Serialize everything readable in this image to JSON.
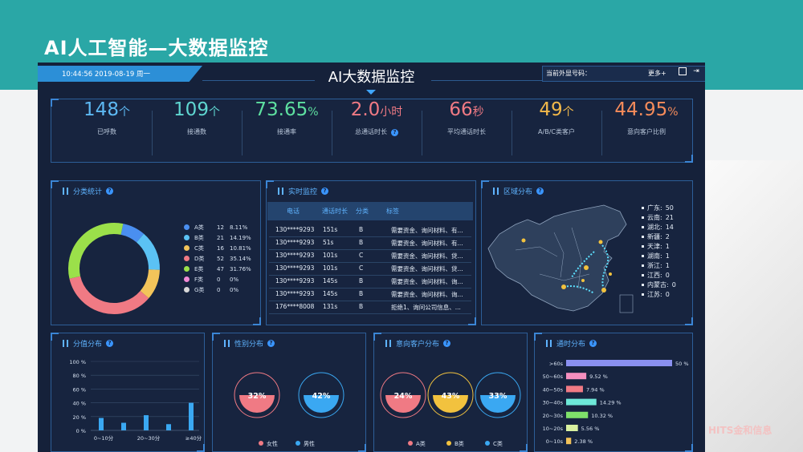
{
  "slide": {
    "title": "AI人工智能—大数据监控",
    "logo": "HITS金和信息"
  },
  "header": {
    "datetime": "10:44:56 2019-08-19 周一",
    "title": "AI大数据监控",
    "current_number_label": "当前外显号码：",
    "more_label": "更多+"
  },
  "kpis": [
    {
      "value": "148",
      "unit": "个",
      "label": "已呼数",
      "color": "#5db8f2"
    },
    {
      "value": "109",
      "unit": "个",
      "label": "接通数",
      "color": "#5fd6d0"
    },
    {
      "value": "73.65",
      "unit": "%",
      "label": "接通率",
      "color": "#5ee0a0"
    },
    {
      "value": "2.0",
      "unit": "小时",
      "label": "总通话时长",
      "color": "#f07a84"
    },
    {
      "value": "66",
      "unit": "秒",
      "label": "平均通话时长",
      "color": "#f07a84"
    },
    {
      "value": "49",
      "unit": "个",
      "label": "A/B/C类客户",
      "color": "#f2b84a"
    },
    {
      "value": "44.95",
      "unit": "%",
      "label": "意向客户比例",
      "color": "#f58b5a"
    }
  ],
  "panels": {
    "classification": "分类统计",
    "realtime": "实时监控",
    "region": "区域分布",
    "score": "分值分布",
    "gender": "性别分布",
    "intent": "意向客户分布",
    "duration": "通时分布"
  },
  "classification": [
    {
      "name": "A类",
      "count": "12",
      "pct": "8.11%",
      "value": 8.11,
      "color": "#4a8ff0"
    },
    {
      "name": "B类",
      "count": "21",
      "pct": "14.19%",
      "value": 14.19,
      "color": "#5bc2f4"
    },
    {
      "name": "C类",
      "count": "16",
      "pct": "10.81%",
      "value": 10.81,
      "color": "#f3c45a"
    },
    {
      "name": "D类",
      "count": "52",
      "pct": "35.14%",
      "value": 35.14,
      "color": "#f07a84"
    },
    {
      "name": "E类",
      "count": "47",
      "pct": "31.76%",
      "value": 31.76,
      "color": "#9be04a"
    },
    {
      "name": "F类",
      "count": "0",
      "pct": "0%",
      "value": 0,
      "color": "#f28ad6"
    },
    {
      "name": "G类",
      "count": "0",
      "pct": "0%",
      "value": 0,
      "color": "#d8d8d8"
    }
  ],
  "realtime": {
    "headers": [
      "电话",
      "通话时长",
      "分类",
      "标签"
    ],
    "rows": [
      [
        "130****9293",
        "151s",
        "B",
        "需要资金、询问材料、有..."
      ],
      [
        "130****9293",
        "51s",
        "B",
        "需要资金、询问材料、有..."
      ],
      [
        "130****9293",
        "101s",
        "C",
        "需要资金、询问材料、贷..."
      ],
      [
        "130****9293",
        "101s",
        "C",
        "需要资金、询问材料、贷..."
      ],
      [
        "130****9293",
        "145s",
        "B",
        "需要资金、询问材料、询..."
      ],
      [
        "130****9293",
        "145s",
        "B",
        "需要资金、询问材料、询..."
      ],
      [
        "176****8008",
        "131s",
        "B",
        "拒绝1、询问公司信息、..."
      ]
    ]
  },
  "regions": [
    {
      "name": "广东:",
      "value": "50"
    },
    {
      "name": "云南:",
      "value": "21"
    },
    {
      "name": "湖北:",
      "value": "14"
    },
    {
      "name": "新疆:",
      "value": "2"
    },
    {
      "name": "天津:",
      "value": "1"
    },
    {
      "name": "湖南:",
      "value": "1"
    },
    {
      "name": "浙江:",
      "value": "1"
    },
    {
      "name": "江西:",
      "value": "0"
    },
    {
      "name": "内蒙古:",
      "value": "0"
    },
    {
      "name": "江苏:",
      "value": "0"
    }
  ],
  "chart_data": [
    {
      "type": "bar",
      "title": "分值分布",
      "y_ticks": [
        "100 %",
        "80 %",
        "60 %",
        "40 %",
        "20 %",
        "0 %"
      ],
      "x_ticks": [
        "0~10分",
        "20~30分",
        "≥40分"
      ],
      "values": [
        18,
        11,
        22,
        9,
        40
      ],
      "ylim": [
        0,
        100
      ]
    },
    {
      "type": "pie",
      "title": "性别分布",
      "series": [
        {
          "name": "女性",
          "value": 32,
          "label": "32%",
          "color": "#f07a84"
        },
        {
          "name": "男性",
          "value": 42,
          "label": "42%",
          "color": "#3aa8f2"
        }
      ]
    },
    {
      "type": "pie",
      "title": "意向客户分布",
      "series": [
        {
          "name": "A类",
          "value": 24,
          "label": "24%",
          "color": "#f07a84"
        },
        {
          "name": "B类",
          "value": 43,
          "label": "43%",
          "color": "#f2c23e"
        },
        {
          "name": "C类",
          "value": 33,
          "label": "33%",
          "color": "#3aa8f2"
        }
      ]
    },
    {
      "type": "bar",
      "title": "通时分布",
      "categories": [
        ">60s",
        "50~60s",
        "40~50s",
        "30~40s",
        "20~30s",
        "10~20s",
        "0~10s"
      ],
      "values": [
        50,
        9.52,
        7.94,
        14.29,
        10.32,
        5.56,
        2.38
      ],
      "labels": [
        "50 %",
        "9.52 %",
        "7.94 %",
        "14.29 %",
        "10.32 %",
        "5.56 %",
        "2.38 %"
      ],
      "colors": [
        "#8a90f0",
        "#f58fbf",
        "#f07a84",
        "#6ee8d8",
        "#7ee06a",
        "#d8f0a0",
        "#f2c25a"
      ]
    }
  ]
}
